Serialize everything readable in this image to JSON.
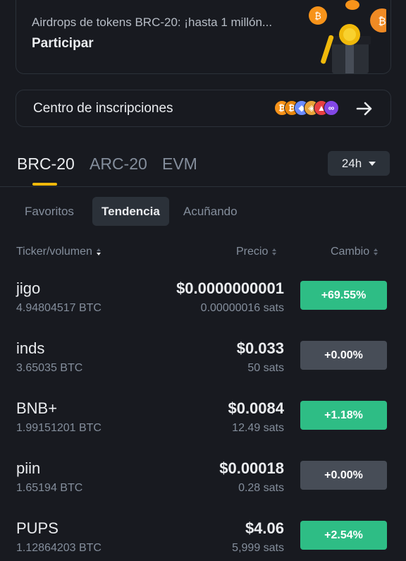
{
  "banner": {
    "subtitle": "Airdrops de tokens BRC-20: ¡hasta 1 millón...",
    "cta": "Participar"
  },
  "inscriptions": {
    "label": "Centro de inscripciones",
    "coins": [
      {
        "icon": "bitcoin-icon",
        "glyph": "₿",
        "color": "#f7931a"
      },
      {
        "icon": "bitcoin-icon",
        "glyph": "₿",
        "color": "#e8870f"
      },
      {
        "icon": "ethereum-icon",
        "glyph": "◆",
        "color": "#6b8cff"
      },
      {
        "icon": "token-icon",
        "glyph": "◈",
        "color": "#e9a43a"
      },
      {
        "icon": "avalanche-icon",
        "glyph": "▲",
        "color": "#e84142"
      },
      {
        "icon": "polygon-icon",
        "glyph": "∞",
        "color": "#8247e5"
      }
    ]
  },
  "protocol_tabs": [
    "BRC-20",
    "ARC-20",
    "EVM"
  ],
  "period": "24h",
  "sub_tabs": [
    "Favoritos",
    "Tendencia",
    "Acuñando"
  ],
  "columns": {
    "ticker": "Ticker/volumen",
    "price": "Precio",
    "change": "Cambio"
  },
  "rows": [
    {
      "ticker": "jigo",
      "volume": "4.94804517 BTC",
      "price": "$0.0000000001",
      "sats": "0.00000016 sats",
      "change": "+69.55%",
      "trend": "pos"
    },
    {
      "ticker": "inds",
      "volume": "3.65035 BTC",
      "price": "$0.033",
      "sats": "50 sats",
      "change": "+0.00%",
      "trend": "zero"
    },
    {
      "ticker": "BNB+",
      "volume": "1.99151201 BTC",
      "price": "$0.0084",
      "sats": "12.49 sats",
      "change": "+1.18%",
      "trend": "pos"
    },
    {
      "ticker": "piin",
      "volume": "1.65194 BTC",
      "price": "$0.00018",
      "sats": "0.28 sats",
      "change": "+0.00%",
      "trend": "zero"
    },
    {
      "ticker": "PUPS",
      "volume": "1.12864203 BTC",
      "price": "$4.06",
      "sats": "5,999 sats",
      "change": "+2.54%",
      "trend": "pos"
    }
  ],
  "colors": {
    "accent": "#f0b90b",
    "positive": "#2ebd85",
    "neutral": "#474d57"
  }
}
